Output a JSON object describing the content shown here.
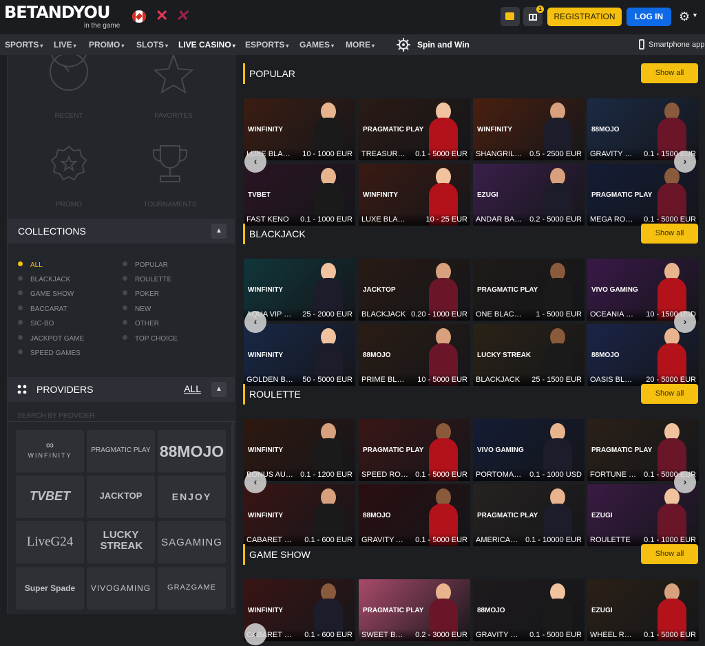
{
  "header": {
    "brand": "BETANDYOU",
    "tagline": "in the game",
    "registration": "REGISTRATION",
    "login": "LOG IN"
  },
  "nav": {
    "items": [
      "SPORTS",
      "LIVE",
      "PROMO",
      "SLOTS",
      "LIVE CASINO",
      "ESPORTS",
      "GAMES",
      "MORE"
    ],
    "active": "LIVE CASINO",
    "spin": "Spin and Win",
    "smartphone": "Smartphone app"
  },
  "quick": {
    "recent": "RECENT",
    "favorites": "FAVORITES",
    "promo": "PROMO",
    "tournaments": "TOURNAMENTS"
  },
  "collections": {
    "title": "COLLECTIONS",
    "left": [
      "ALL",
      "BLACKJACK",
      "GAME SHOW",
      "BACCARAT",
      "SIC-BO",
      "JACKPOT GAME",
      "SPEED GAMES"
    ],
    "right": [
      "POPULAR",
      "ROULETTE",
      "POKER",
      "NEW",
      "OTHER",
      "TOP CHOICE"
    ],
    "active": "ALL"
  },
  "providers": {
    "title": "PROVIDERS",
    "all": "ALL",
    "search_placeholder": "SEARCH BY PROVIDER",
    "tiles": [
      "WINFINITY",
      "PRAGMATIC PLAY",
      "88MOJO",
      "TVBET",
      "JACKTOP",
      "ENJOY",
      "LiveG24",
      "LUCKY STREAK",
      "SAGAMING",
      "Super Spade",
      "VIVOGAMING",
      "GRAZGAME"
    ]
  },
  "show_all": "Show all",
  "sections": [
    {
      "title": "POPULAR",
      "games": [
        {
          "name": "LUXE BLACKJACK",
          "limit": "10 - 1000 EUR",
          "provider": "WINFINITY",
          "bg": "#3b1d12"
        },
        {
          "name": "TREASURE ISLAND",
          "limit": "0.1 - 5000 EUR",
          "provider": "PRAGMATIC PLAY",
          "bg": "#2a1a14"
        },
        {
          "name": "SHANGRILA ROULETTE",
          "limit": "0.5 - 2500 EUR",
          "provider": "WINFINITY",
          "bg": "#4a1f0f"
        },
        {
          "name": "GRAVITY BLACKJACK",
          "limit": "0.1 - 1500 EUR",
          "provider": "88MOJO",
          "bg": "#1b2a44"
        },
        {
          "name": "FAST KENO",
          "limit": "0.1 - 1000 EUR",
          "provider": "TVBET",
          "bg": "#2a1423"
        },
        {
          "name": "LUXE BLACKJACK",
          "limit": "10 - 25 EUR",
          "provider": "WINFINITY",
          "bg": "#3a1a12"
        },
        {
          "name": "ANDAR BAHAR",
          "limit": "0.2 - 5000 EUR",
          "provider": "EZUGI",
          "bg": "#3a1f4a"
        },
        {
          "name": "MEGA ROULETTE",
          "limit": "0.1 - 5000 EUR",
          "provider": "PRAGMATIC PLAY",
          "bg": "#141c36"
        }
      ]
    },
    {
      "title": "BLACKJACK",
      "games": [
        {
          "name": "AQUA VIP BLACKJACK",
          "limit": "25 - 2000 EUR",
          "provider": "WINFINITY",
          "bg": "#10363a"
        },
        {
          "name": "BLACKJACK",
          "limit": "0.20 - 1000 EUR",
          "provider": "JACKTOP",
          "bg": "#281a14"
        },
        {
          "name": "ONE BLACKJACK",
          "limit": "1 - 5000 EUR",
          "provider": "PRAGMATIC PLAY",
          "bg": "#1e1a18"
        },
        {
          "name": "OCEANIA VIP",
          "limit": "10 - 1500 USD",
          "provider": "VIVO GAMING",
          "bg": "#3a1848"
        },
        {
          "name": "GOLDEN BLACKJACK",
          "limit": "50 - 5000 EUR",
          "provider": "WINFINITY",
          "bg": "#182848"
        },
        {
          "name": "PRIME BLACKJACK",
          "limit": "10 - 5000 EUR",
          "provider": "88MOJO",
          "bg": "#2a1c14"
        },
        {
          "name": "BLACKJACK",
          "limit": "25 - 1500 EUR",
          "provider": "LUCKY STREAK",
          "bg": "#2a2216"
        },
        {
          "name": "OASIS BLACKJACK",
          "limit": "20 - 5000 EUR",
          "provider": "88MOJO",
          "bg": "#1a2448"
        }
      ]
    },
    {
      "title": "ROULETTE",
      "games": [
        {
          "name": "BONUS AUTO ROULETTE",
          "limit": "0.1 - 1200 EUR",
          "provider": "WINFINITY",
          "bg": "#2e1810"
        },
        {
          "name": "SPEED ROULETTE",
          "limit": "0.1 - 5000 EUR",
          "provider": "PRAGMATIC PLAY",
          "bg": "#3a1616"
        },
        {
          "name": "PORTOMASO ROULETTE",
          "limit": "0.1 - 1000 USD",
          "provider": "VIVO GAMING",
          "bg": "#141c34"
        },
        {
          "name": "FORTUNE ROULETTE",
          "limit": "0.1 - 5000 EUR",
          "provider": "PRAGMATIC PLAY",
          "bg": "#2a2018"
        },
        {
          "name": "CABARET ROULETTE",
          "limit": "0.1 - 600 EUR",
          "provider": "WINFINITY",
          "bg": "#3a1414"
        },
        {
          "name": "GRAVITY AUTO ROULETTE",
          "limit": "0.1 - 5000 EUR",
          "provider": "88MOJO",
          "bg": "#2a0e10"
        },
        {
          "name": "AMERICAN ROULETTE",
          "limit": "0.1 - 10000 EUR",
          "provider": "PRAGMATIC PLAY",
          "bg": "#262220"
        },
        {
          "name": "ROULETTE",
          "limit": "0.1 - 1000 EUR",
          "provider": "EZUGI",
          "bg": "#3a1a44"
        }
      ]
    },
    {
      "title": "GAME SHOW",
      "games": [
        {
          "name": "CABARET ROULETTE",
          "limit": "0.1 - 600 EUR",
          "provider": "WINFINITY",
          "bg": "#3a1414"
        },
        {
          "name": "SWEET BONANZA CANDYLAND",
          "limit": "0.2 - 3000 EUR",
          "provider": "PRAGMATIC PLAY",
          "bg": "#a84a6a"
        },
        {
          "name": "GRAVITY ROULETTE",
          "limit": "0.1 - 5000 EUR",
          "provider": "88MOJO",
          "bg": "#1e1a1c"
        },
        {
          "name": "WHEEL ROULETTE",
          "limit": "0.1 - 5000 EUR",
          "provider": "EZUGI",
          "bg": "#2a2016"
        }
      ]
    }
  ]
}
